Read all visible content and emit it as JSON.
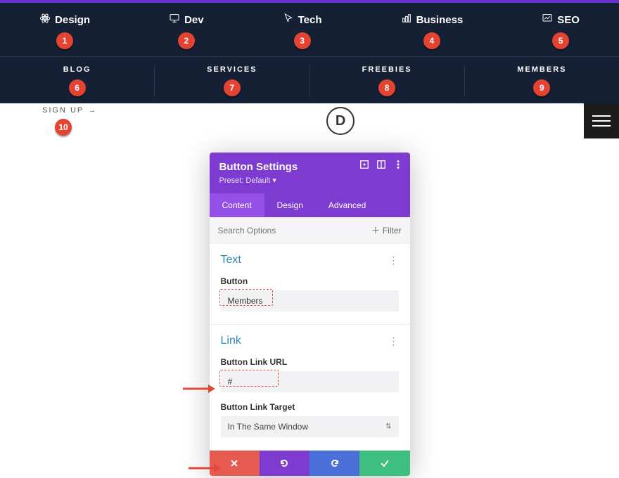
{
  "topnav": [
    {
      "label": "Design",
      "icon": "atom-icon",
      "badge": "1"
    },
    {
      "label": "Dev",
      "icon": "monitor-icon",
      "badge": "2"
    },
    {
      "label": "Tech",
      "icon": "cursor-icon",
      "badge": "3"
    },
    {
      "label": "Business",
      "icon": "chart-icon",
      "badge": "4"
    },
    {
      "label": "SEO",
      "icon": "seo-icon",
      "badge": "5"
    }
  ],
  "subnav": [
    {
      "label": "BLOG",
      "badge": "6"
    },
    {
      "label": "SERVICES",
      "badge": "7"
    },
    {
      "label": "FREEBIES",
      "badge": "8"
    },
    {
      "label": "MEMBERS",
      "badge": "9"
    }
  ],
  "signup": {
    "label": "SIGN UP",
    "arrow": "→",
    "badge": "10"
  },
  "logo": "D",
  "modal": {
    "title": "Button Settings",
    "preset_label": "Preset: Default",
    "tabs": {
      "content": "Content",
      "design": "Design",
      "advanced": "Advanced"
    },
    "search_placeholder": "Search Options",
    "filter_label": "Filter",
    "sections": {
      "text": {
        "title": "Text",
        "button_label": "Button",
        "button_value": "Members"
      },
      "link": {
        "title": "Link",
        "url_label": "Button Link URL",
        "url_value": "#",
        "target_label": "Button Link Target",
        "target_value": "In The Same Window"
      }
    }
  }
}
